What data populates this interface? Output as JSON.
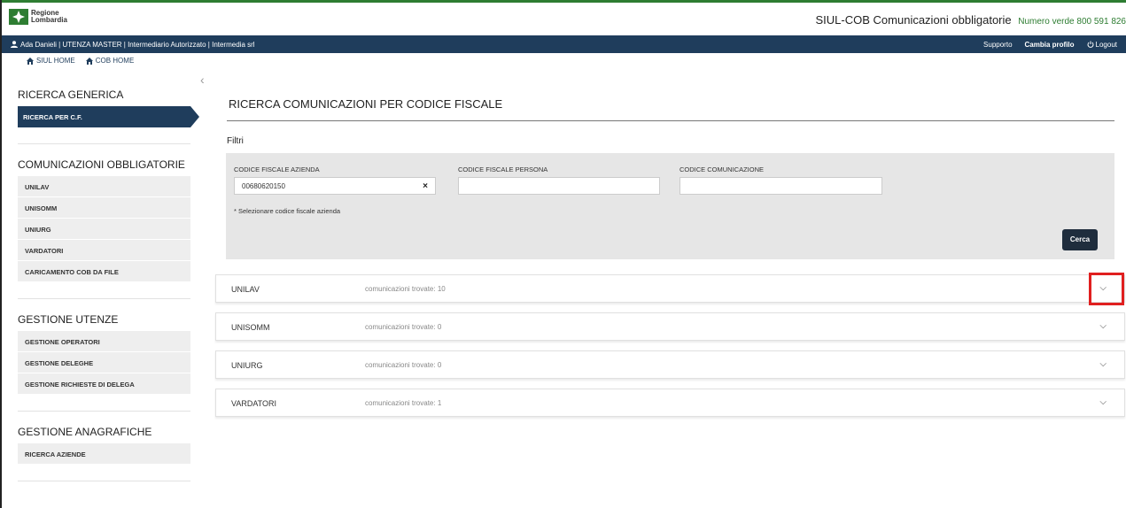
{
  "header": {
    "logo_line1": "Regione",
    "logo_line2": "Lombardia",
    "app_name": "SIUL-COB",
    "app_subtitle": "Comunicazioni obbligatorie",
    "phone": "Numero verde 800 591 826"
  },
  "userbar": {
    "user_info": "Ada Danieli | UTENZA MASTER | Intermediario Autorizzato | Intermedia srl",
    "supporto": "Supporto",
    "cambia_profilo": "Cambia profilo",
    "logout": "Logout"
  },
  "crumbs": {
    "siul_home": "SIUL HOME",
    "cob_home": "COB HOME"
  },
  "sidebar": {
    "ricerca_title": "RICERCA GENERICA",
    "ricerca_active": "RICERCA PER C.F.",
    "comunicazioni_title": "COMUNICAZIONI OBBLIGATORIE",
    "comunicazioni_items": [
      "UNILAV",
      "UNISOMM",
      "UNIURG",
      "VARDATORI",
      "CARICAMENTO COB DA FILE"
    ],
    "utenze_title": "GESTIONE UTENZE",
    "utenze_items": [
      "GESTIONE OPERATORI",
      "GESTIONE DELEGHE",
      "GESTIONE RICHIESTE DI DELEGA"
    ],
    "anagrafiche_title": "GESTIONE ANAGRAFICHE",
    "anagrafiche_items": [
      "RICERCA AZIENDE"
    ]
  },
  "main": {
    "title": "RICERCA COMUNICAZIONI PER CODICE FISCALE",
    "filtri": "Filtri",
    "label_cf_azienda": "CODICE FISCALE AZIENDA",
    "value_cf_azienda": "00680620150",
    "label_cf_persona": "CODICE FISCALE PERSONA",
    "value_cf_persona": "",
    "label_codice_com": "CODICE COMUNICAZIONE",
    "value_codice_com": "",
    "note": "* Selezionare codice fiscale azienda",
    "cerca": "Cerca"
  },
  "results": [
    {
      "name": "UNILAV",
      "count": "comunicazioni trovate: 10"
    },
    {
      "name": "UNISOMM",
      "count": "comunicazioni trovate: 0"
    },
    {
      "name": "UNIURG",
      "count": "comunicazioni trovate: 0"
    },
    {
      "name": "VARDATORI",
      "count": "comunicazioni trovate: 1"
    }
  ],
  "colors": {
    "navy": "#1f3d5c",
    "green": "#2e7d32",
    "highlight": "#e01f1f"
  }
}
